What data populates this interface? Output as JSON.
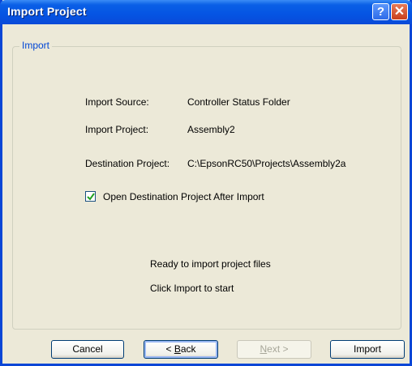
{
  "window": {
    "title": "Import Project",
    "help_symbol": "?",
    "close_symbol": "✕"
  },
  "group": {
    "label": "Import"
  },
  "fields": {
    "source_label": "Import Source:",
    "source_value": "Controller Status Folder",
    "project_label": "Import Project:",
    "project_value": "Assembly2",
    "destination_label": "Destination Project:",
    "destination_value": "C:\\EpsonRC50\\Projects\\Assembly2a"
  },
  "option": {
    "label": "Open Destination Project After Import",
    "checked": true
  },
  "status": {
    "line1": "Ready to import project files",
    "line2": "Click Import to start"
  },
  "buttons": {
    "cancel": "Cancel",
    "back_mnemonic": "B",
    "back_prefix": "< ",
    "back_rest": "ack",
    "next_mnemonic": "N",
    "next_rest": "ext >",
    "import": "Import"
  }
}
